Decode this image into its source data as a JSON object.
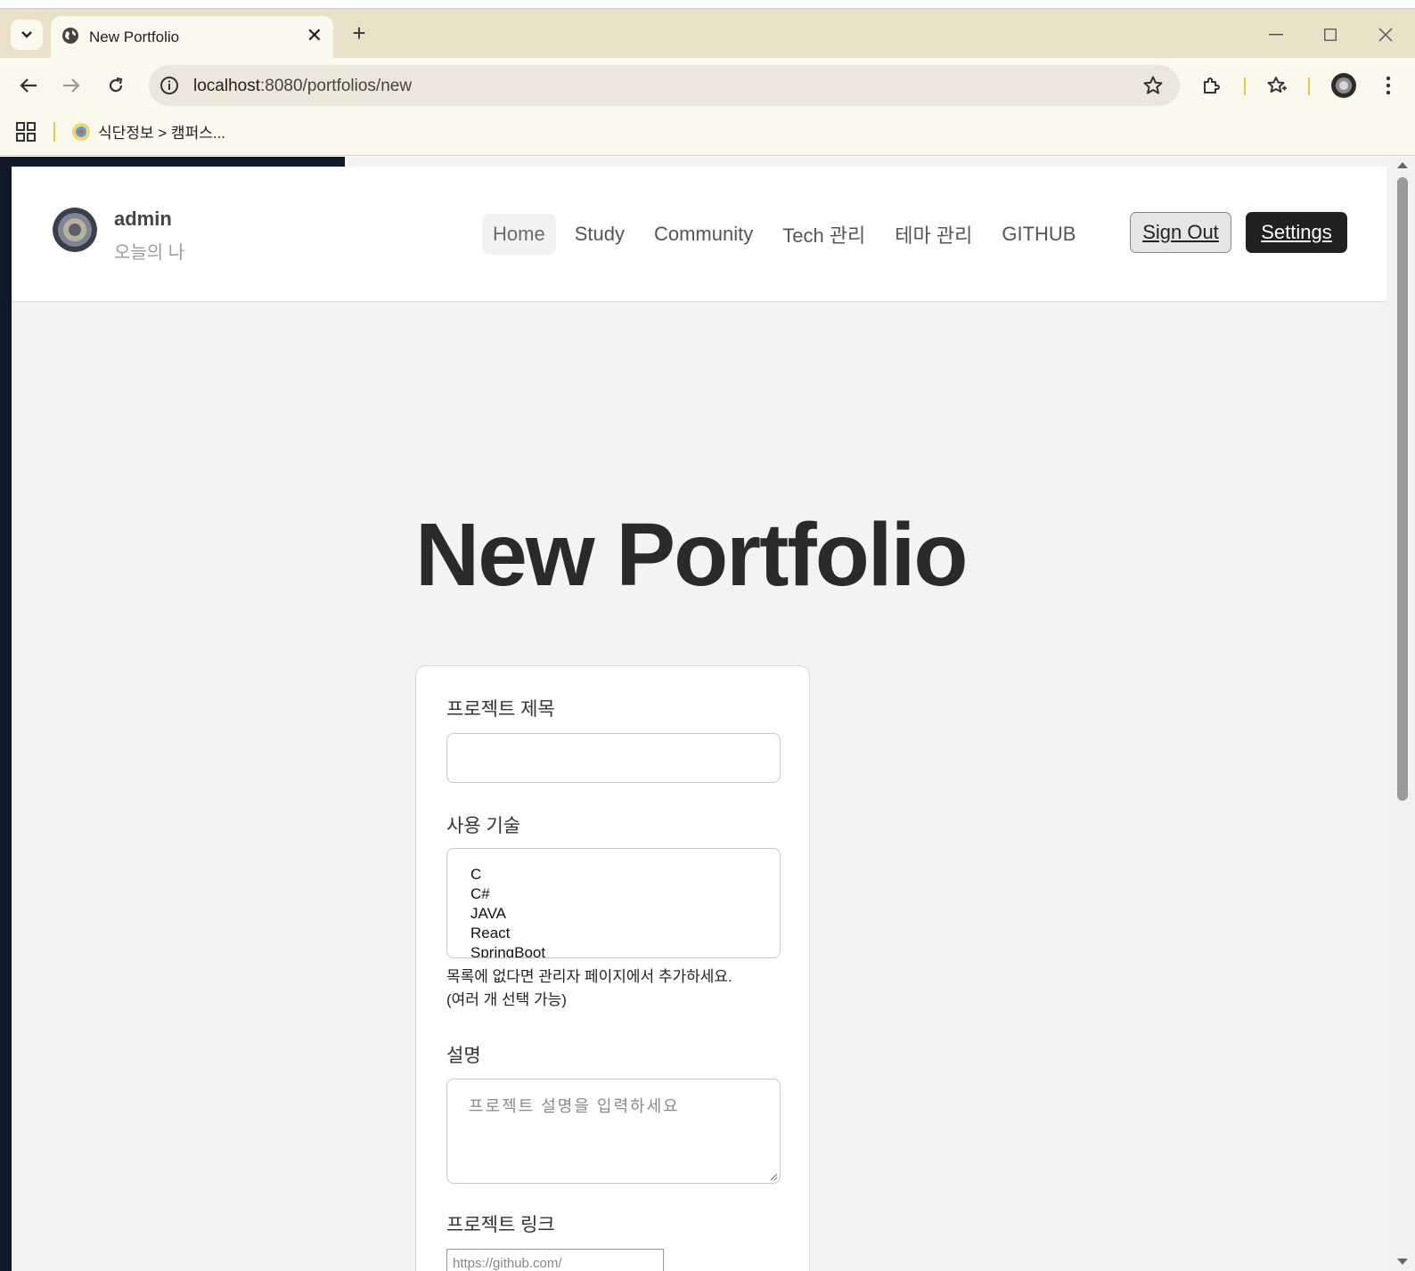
{
  "browser": {
    "tab_title": "New Portfolio",
    "url_host": "localhost",
    "url_path": ":8080/portfolios/new",
    "bookmark_label": "식단정보 > 캠퍼스..."
  },
  "header": {
    "brand_name": "admin",
    "brand_subtitle": "오늘의 나",
    "nav": [
      "Home",
      "Study",
      "Community",
      "Tech 관리",
      "테마 관리",
      "GITHUB"
    ],
    "sign_out": "Sign Out",
    "settings": "Settings"
  },
  "page": {
    "title": "New Portfolio"
  },
  "form": {
    "title_label": "프로젝트 제목",
    "title_value": "",
    "tech_label": "사용 기술",
    "tech_options": [
      "C",
      "C#",
      "JAVA",
      "React",
      "SpringBoot"
    ],
    "tech_help_1": "목록에 없다면 관리자 페이지에서 추가하세요.",
    "tech_help_2": "(여러 개 선택 가능)",
    "desc_label": "설명",
    "desc_placeholder": "프로젝트 설명을 입력하세요",
    "link_label": "프로젝트 링크",
    "link_placeholder": "https://github.com/"
  },
  "colors": {
    "accent_dark": "#111827",
    "tabstrip": "#e9e2c8",
    "toolbar": "#fbf8ee",
    "settings_button": "#212121"
  }
}
